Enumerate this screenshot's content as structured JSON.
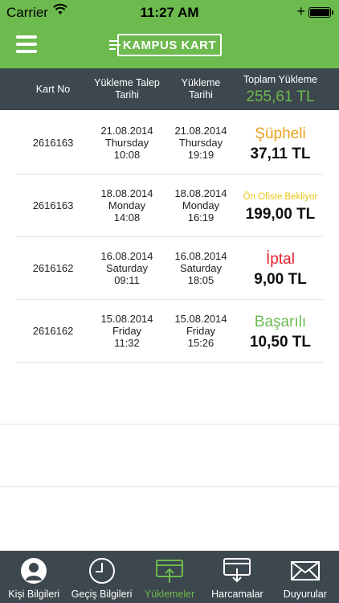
{
  "status_bar": {
    "carrier": "Carrier",
    "time": "11:27 AM"
  },
  "nav": {
    "logo_text": "KAMPUS KART",
    "menu_icon": "hamburger-icon"
  },
  "table_header": {
    "col_card": "Kart No",
    "col_request_line1": "Yükleme Talep",
    "col_request_line2": "Tarihi",
    "col_load_line1": "Yükleme",
    "col_load_line2": "Tarihi",
    "total_label": "Toplam Yükleme",
    "total_value": "255,61 TL"
  },
  "rows": [
    {
      "card": "2616163",
      "req_date": "21.08.2014",
      "req_day": "Thursday",
      "req_time": "10:08",
      "load_date": "21.08.2014",
      "load_day": "Thursday",
      "load_time": "19:19",
      "status": "Şüpheli",
      "status_color": "#e8a31c",
      "amount": "37,11 TL"
    },
    {
      "card": "2616163",
      "req_date": "18.08.2014",
      "req_day": "Monday",
      "req_time": "14:08",
      "load_date": "18.08.2014",
      "load_day": "Monday",
      "load_time": "16:19",
      "status": "Ön Ofiste Bekliyor",
      "status_color": "#e5c414",
      "amount": "199,00 TL"
    },
    {
      "card": "2616162",
      "req_date": "16.08.2014",
      "req_day": "Saturday",
      "req_time": "09:11",
      "load_date": "16.08.2014",
      "load_day": "Saturday",
      "load_time": "18:05",
      "status": "İptal",
      "status_color": "#e0242c",
      "amount": "9,00 TL"
    },
    {
      "card": "2616162",
      "req_date": "15.08.2014",
      "req_day": "Friday",
      "req_time": "11:32",
      "load_date": "15.08.2014",
      "load_day": "Friday",
      "load_time": "15:26",
      "status": "Başarılı",
      "status_color": "#6dba4f",
      "amount": "10,50 TL"
    }
  ],
  "tabs": [
    {
      "label": "Kişi Bilgileri",
      "icon": "person-icon",
      "active": false
    },
    {
      "label": "Geçiş Bilgileri",
      "icon": "clock-icon",
      "active": false
    },
    {
      "label": "Yüklemeler",
      "icon": "card-upload-icon",
      "active": true
    },
    {
      "label": "Harcamalar",
      "icon": "card-download-icon",
      "active": false
    },
    {
      "label": "Duyurular",
      "icon": "envelope-icon",
      "active": false
    }
  ],
  "colors": {
    "brand_green": "#6dba4f",
    "header_dark": "#3d474e"
  }
}
